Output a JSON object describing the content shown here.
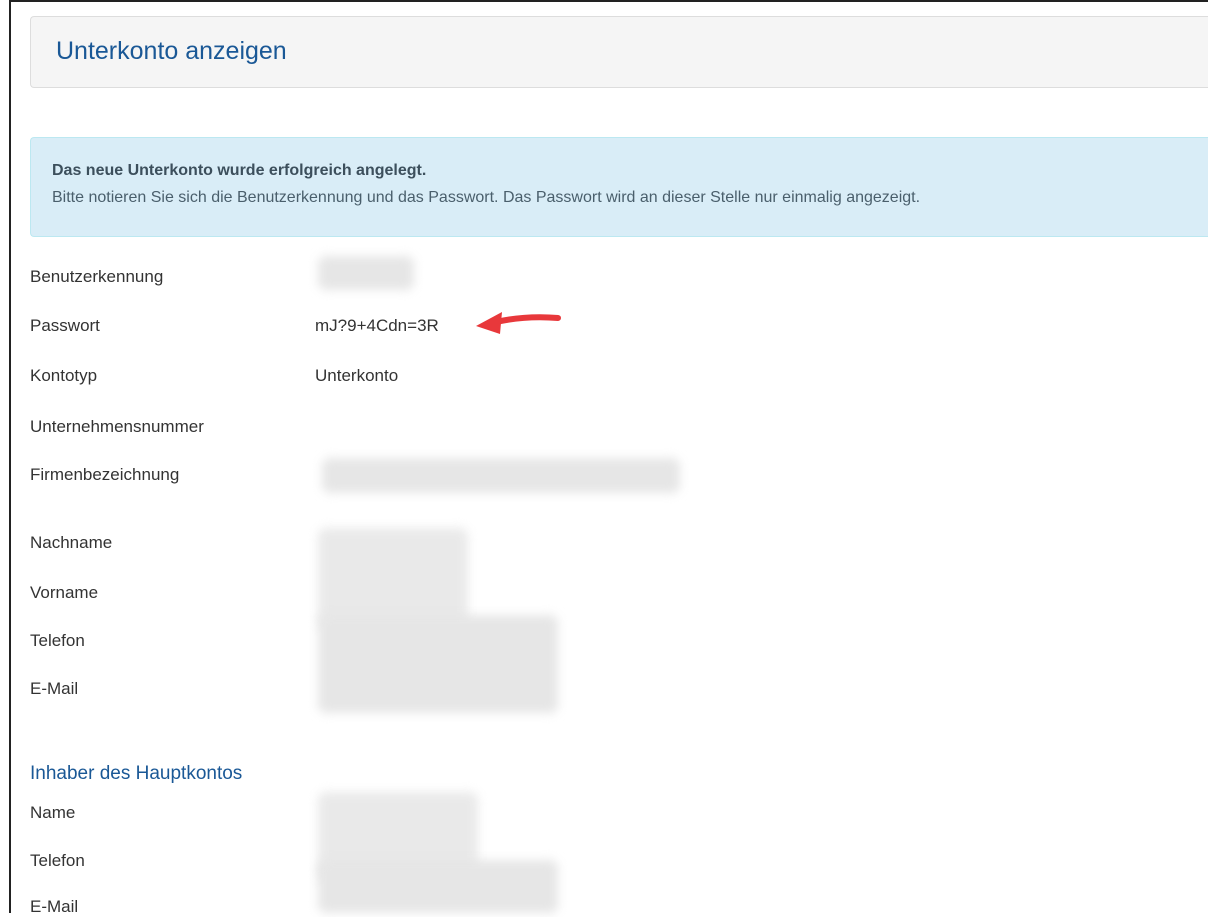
{
  "panel": {
    "title": "Unterkonto anzeigen"
  },
  "alert": {
    "title": "Das neue Unterkonto wurde erfolgreich angelegt.",
    "text": "Bitte notieren Sie sich die Benutzerkennung und das Passwort. Das Passwort wird an dieser Stelle nur einmalig angezeigt."
  },
  "fields": {
    "benutzerkennung": {
      "label": "Benutzerkennung",
      "value": ""
    },
    "passwort": {
      "label": "Passwort",
      "value": "mJ?9+4Cdn=3R"
    },
    "kontotyp": {
      "label": "Kontotyp",
      "value": "Unterkonto"
    },
    "unternehmensnummer": {
      "label": "Unternehmensnummer",
      "value": ""
    },
    "firmenbezeichnung": {
      "label": "Firmenbezeichnung",
      "value": ""
    },
    "nachname": {
      "label": "Nachname",
      "value": ""
    },
    "vorname": {
      "label": "Vorname",
      "value": ""
    },
    "telefon": {
      "label": "Telefon",
      "value": ""
    },
    "email": {
      "label": "E-Mail",
      "value": ""
    }
  },
  "owner": {
    "title": "Inhaber des Hauptkontos",
    "name_label": "Name",
    "telefon_label": "Telefon",
    "email_label": "E-Mail"
  },
  "colors": {
    "heading": "#1a5896",
    "alert_bg": "#d9edf7",
    "annotation_arrow": "#e8383b"
  },
  "icons": {
    "annotation": "red-arrow-icon"
  }
}
